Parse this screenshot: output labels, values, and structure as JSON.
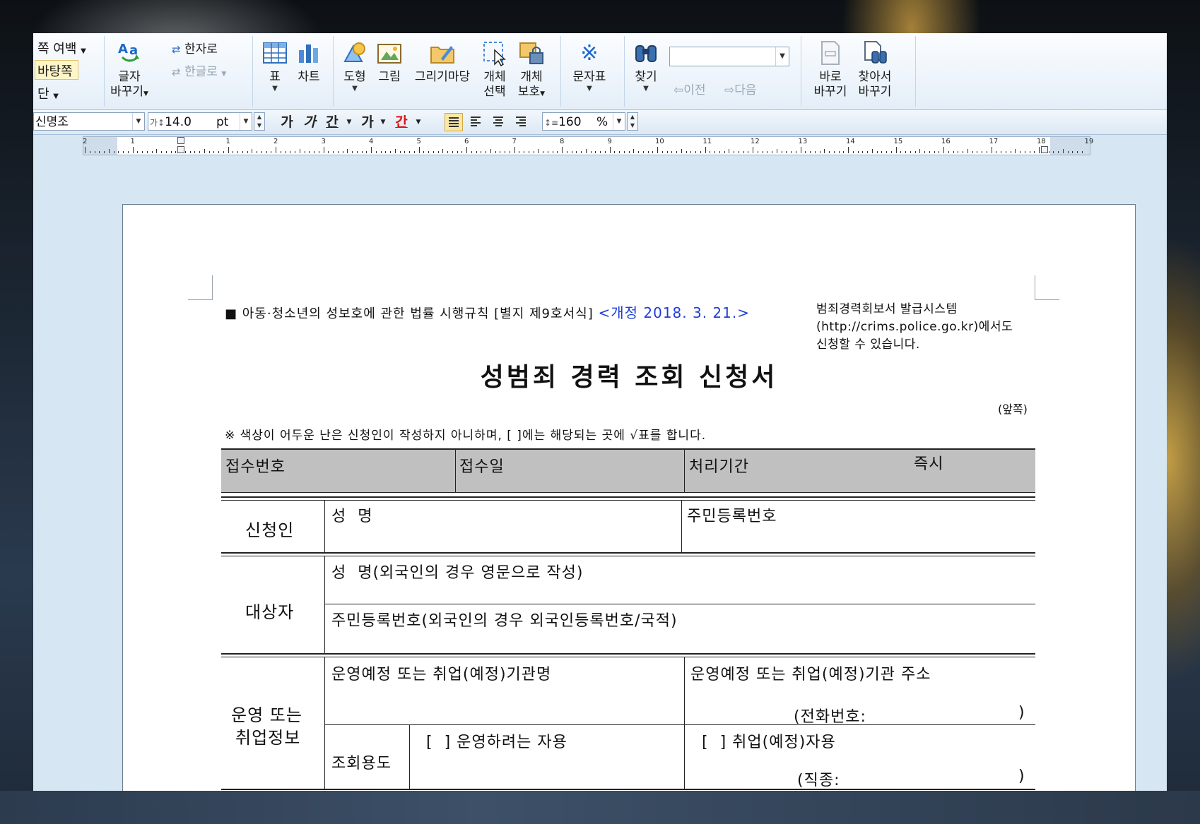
{
  "ribbon": {
    "page_margin": "쪽 여백",
    "background": "바탕쪽",
    "column": "단",
    "change_char_top": "글자",
    "change_char_bottom": "바꾸기",
    "to_hanja": "한자로",
    "to_hangul": "한글로",
    "table": "표",
    "chart": "차트",
    "shape": "도형",
    "picture": "그림",
    "drawing_wizard": "그리기마당",
    "select_object_top": "개체",
    "select_object_bottom": "선택",
    "protect_object_top": "개체",
    "protect_object_bottom": "보호",
    "symbol": "문자표",
    "find": "찾기",
    "search_value": "",
    "prev": "이전",
    "next": "다음",
    "replace_top": "바로",
    "replace_bottom": "바꾸기",
    "find_replace_top": "찾아서",
    "find_replace_bottom": "바꾸기"
  },
  "format_bar": {
    "font": "신명조",
    "size": "14.0",
    "size_unit": "pt",
    "bold": "가",
    "italic": "가",
    "underline": "간",
    "strike": "가",
    "color": "간",
    "line_spacing": "160",
    "line_spacing_unit": "%"
  },
  "ruler": {
    "numbers": [
      "2",
      "1",
      "",
      "1",
      "2",
      "3",
      "4",
      "5",
      "6",
      "7",
      "8",
      "9",
      "10",
      "11",
      "12",
      "13",
      "14",
      "15",
      "16",
      "17",
      "18",
      "19"
    ]
  },
  "document": {
    "header_prefix": "■ 아동·청소년의 성보호에 관한 법률 시행규칙 [별지 제9호서식]",
    "revision": "<개정 2018. 3. 21.>",
    "side_note_1": "범죄경력회보서 발급시스템",
    "side_note_2": "(http://crims.police.go.kr)에서도",
    "side_note_3": "신청할 수 있습니다.",
    "title": "성범죄 경력 조회 신청서",
    "front_side": "(앞쪽)",
    "instruction": "※ 색상이 어두운 난은 신청인이 작성하지 아니하며, [ ]에는 해당되는 곳에 √표를 합니다.",
    "receipt_no": "접수번호",
    "receipt_date": "접수일",
    "processing_period": "처리기간",
    "immediate": "즉시",
    "applicant": "신청인",
    "name": "성  명",
    "resident_no": "주민등록번호",
    "subject": "대상자",
    "subject_name": "성  명(외국인의 경우 영문으로 작성)",
    "subject_resident_no": "주민등록번호(외국인의 경우 외국인등록번호/국적)",
    "employment_info_1": "운영 또는",
    "employment_info_2": "취업정보",
    "org_name": "운영예정 또는 취업(예정)기관명",
    "org_address": "운영예정 또는 취업(예정)기관 주소",
    "phone": "(전화번호:",
    "phone_close": ")",
    "purpose": "조회용도",
    "purpose_operate": "[  ] 운영하려는 자용",
    "purpose_employ": "[  ] 취업(예정)자용",
    "job_type": "(직종:",
    "job_close": ")"
  },
  "colors": {
    "revision_blue": "#1f3fd6",
    "gray_cell": "#c0c0c0",
    "ribbon_bg": "#e4eef8"
  }
}
